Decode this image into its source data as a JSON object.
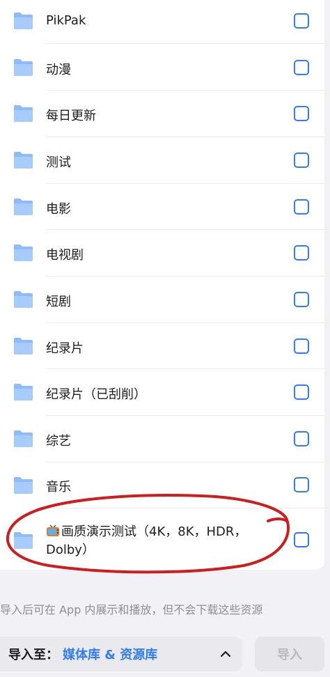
{
  "folders": [
    {
      "name": "PikPak"
    },
    {
      "name": "动漫"
    },
    {
      "name": "每日更新"
    },
    {
      "name": "测试"
    },
    {
      "name": "电影"
    },
    {
      "name": "电视剧"
    },
    {
      "name": "短剧"
    },
    {
      "name": "纪录片"
    },
    {
      "name": "纪录片（已刮削）"
    },
    {
      "name": "综艺"
    },
    {
      "name": "音乐"
    },
    {
      "name": "画质演示测试（4K，8K，HDR，Dolby）",
      "emoji_icon": "tv-icon"
    }
  ],
  "hint_text": "导入后可在 App 内展示和播放，但不会下载这些资源",
  "destination": {
    "label": "导入至：",
    "value": "媒体库 & 资源库"
  },
  "import_button": {
    "label": "导入",
    "enabled": false
  },
  "colors": {
    "accent": "#2f7cf6",
    "folder": "#8ebcf8",
    "annotation": "#d01c1c"
  }
}
